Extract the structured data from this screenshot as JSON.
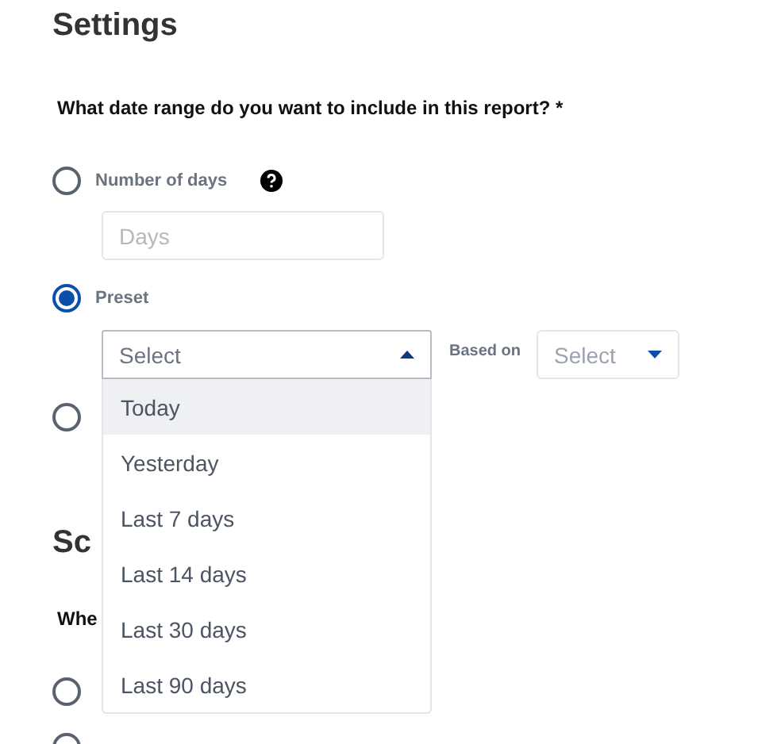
{
  "heading": "Settings",
  "question": "What date range do you want to include in this report? *",
  "options": [
    {
      "label": "Number of days",
      "selected": false,
      "help": true
    },
    {
      "label": "Preset",
      "selected": true
    },
    {
      "selected": false
    }
  ],
  "days_field": {
    "placeholder": "Days"
  },
  "preset_select": {
    "placeholder": "Select",
    "expanded": true,
    "options": [
      {
        "label": "Today",
        "highlighted": true
      },
      {
        "label": "Yesterday",
        "highlighted": false
      },
      {
        "label": "Last 7 days",
        "highlighted": false
      },
      {
        "label": "Last 14 days",
        "highlighted": false
      },
      {
        "label": "Last 30 days",
        "highlighted": false
      },
      {
        "label": "Last 90 days",
        "highlighted": false
      }
    ]
  },
  "based_on": {
    "label": "Based on",
    "placeholder": "Select",
    "expanded": false
  },
  "schedule_heading": "Sc",
  "schedule_question": "Whe",
  "schedule_options": [
    {
      "selected": false
    },
    {
      "selected": false
    }
  ]
}
